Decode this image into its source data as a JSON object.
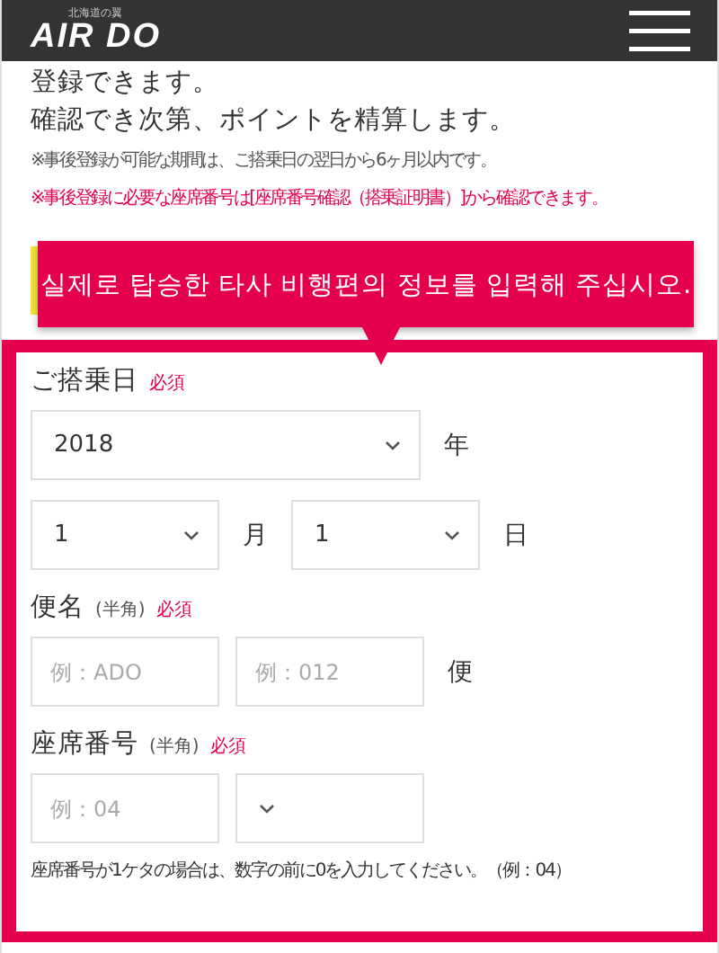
{
  "header": {
    "tagline": "北海道の翼",
    "logo": "AIR DO"
  },
  "intro": {
    "lines": [
      "登録できます。",
      "確認でき次第、ポイントを精算します。"
    ],
    "notes": [
      {
        "kind": "gray",
        "text": "※事後登録が可能な期間は、ご搭乗日の翌日から6ヶ月以内です。"
      },
      {
        "kind": "red",
        "text": "※事後登録に必要な座席番号は[座席番号確認（搭乗証明書）]から確認できます。"
      }
    ]
  },
  "callout": {
    "text": "실제로 탑승한 타사 비행편의 정보를 입력해 주십시오."
  },
  "form": {
    "sections": [
      {
        "label": "ご搭乗日",
        "required": "必須",
        "rows": [
          [
            {
              "kind": "select",
              "value": "2018"
            },
            {
              "kind": "unit",
              "text": "年"
            }
          ],
          [
            {
              "kind": "select",
              "value": "1"
            },
            {
              "kind": "unit",
              "text": "月"
            },
            {
              "kind": "select",
              "value": "1"
            },
            {
              "kind": "unit",
              "text": "日"
            }
          ]
        ]
      },
      {
        "label": "便名",
        "hint": "(半角)",
        "required": "必須",
        "rows": [
          [
            {
              "kind": "input",
              "placeholder": "例：ADO"
            },
            {
              "kind": "input",
              "placeholder": "例：012"
            },
            {
              "kind": "unit",
              "text": "便"
            }
          ]
        ]
      },
      {
        "label": "座席番号",
        "hint": "(半角)",
        "required": "必須",
        "rows": [
          [
            {
              "kind": "input",
              "placeholder": "例：04"
            },
            {
              "kind": "select"
            }
          ]
        ]
      }
    ],
    "note": "座席番号が1ケタの場合は、数字の前に0を入力してください。（例：04）"
  }
}
